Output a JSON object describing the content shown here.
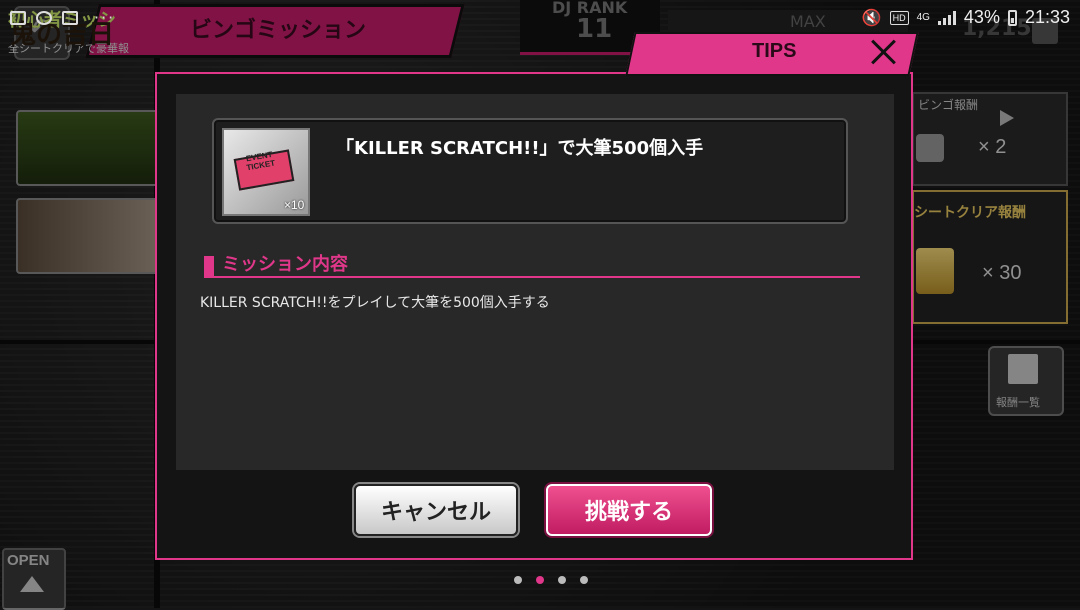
{
  "status_bar": {
    "battery": "43%",
    "time": "21:33",
    "network": "4G",
    "hd_label": "HD",
    "more_dots": "···"
  },
  "game_header": {
    "screen_title": "ビンゴミッション",
    "dj_rank_label": "DJ RANK",
    "dj_rank_value": "11",
    "stamina_max_label": "MAX",
    "coins": "1,215"
  },
  "left_panel": {
    "beginner_mission_title": "初心者ミッシ",
    "beginner_mission_sub": "全シートクリアで豪華報",
    "event_banner_title": "鬼の吉日",
    "open_label": "OPEN"
  },
  "right_panel": {
    "bingo_reward_title": "ビンゴ報酬",
    "bingo_reward_qty": "× 2",
    "sheet_clear_title": "シートクリア報酬",
    "sheet_clear_qty": "× 30",
    "reward_list_label": "報酬一覧"
  },
  "modal": {
    "tab_title": "TIPS",
    "reward_item": {
      "icon": "event-ticket-icon",
      "ticket_text": "EVENT TICKET",
      "quantity": "×10"
    },
    "mission_title": "「KILLER SCRATCH!!」で大筆500個入手",
    "section_title": "ミッション内容",
    "mission_description": "KILLER SCRATCH!!をプレイして大筆を500個入手する",
    "cancel_label": "キャンセル",
    "confirm_label": "挑戦する"
  },
  "pager": {
    "count": 4,
    "active_index": 1
  },
  "colors": {
    "accent_pink": "#e0378a",
    "modal_bg": "#282828",
    "frame_bg": "#141414"
  }
}
